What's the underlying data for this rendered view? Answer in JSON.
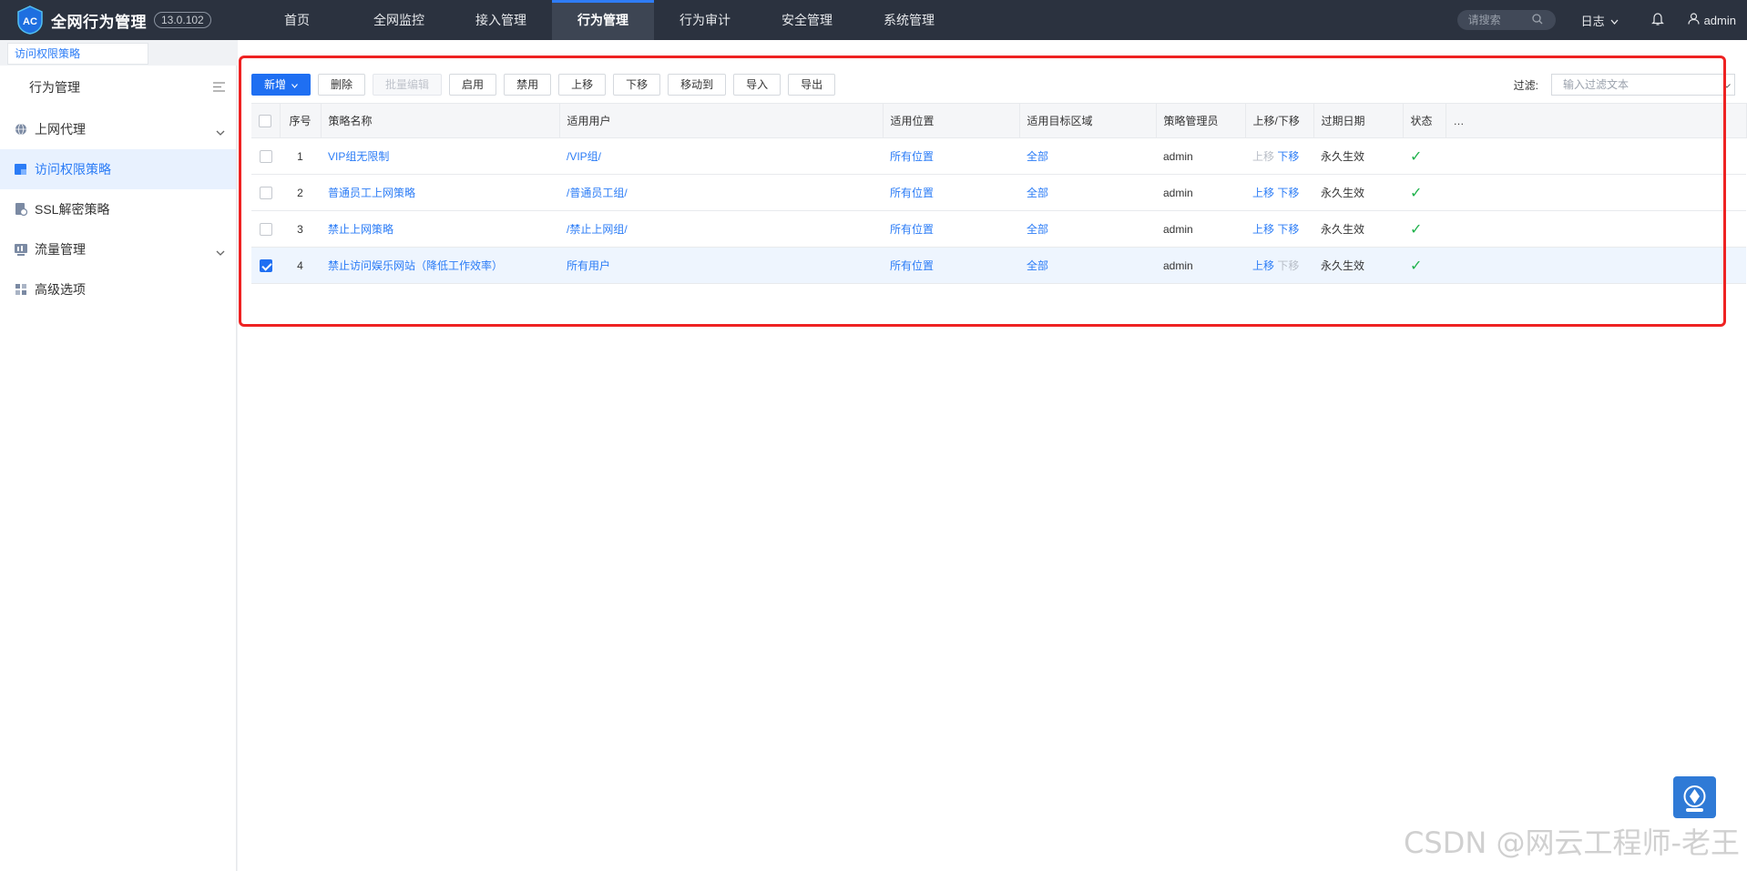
{
  "app": {
    "logo_text": "AC",
    "title": "全网行为管理",
    "version": "13.0.102"
  },
  "nav": {
    "items": [
      {
        "label": "首页"
      },
      {
        "label": "全网监控"
      },
      {
        "label": "接入管理"
      },
      {
        "label": "行为管理",
        "active": true
      },
      {
        "label": "行为审计"
      },
      {
        "label": "安全管理"
      },
      {
        "label": "系统管理"
      }
    ]
  },
  "topright": {
    "search_placeholder": "请搜索",
    "log_label": "日志",
    "user": "admin"
  },
  "breadcrumb": {
    "tab": "访问权限策略"
  },
  "sidebar": {
    "header": "行为管理",
    "items": [
      {
        "label": "上网代理",
        "icon": "globe-icon",
        "expandable": true
      },
      {
        "label": "访问权限策略",
        "icon": "shield-icon",
        "active": true
      },
      {
        "label": "SSL解密策略",
        "icon": "lock-doc-icon"
      },
      {
        "label": "流量管理",
        "icon": "traffic-icon",
        "expandable": true
      },
      {
        "label": "高级选项",
        "icon": "grid-icon"
      }
    ]
  },
  "toolbar": {
    "new": "新增",
    "delete": "删除",
    "batch_edit": "批量编辑",
    "enable": "启用",
    "disable": "禁用",
    "move_up": "上移",
    "move_down": "下移",
    "move_to": "移动到",
    "import": "导入",
    "export": "导出"
  },
  "filter": {
    "label": "过滤:",
    "placeholder": "输入过滤文本"
  },
  "table": {
    "headers": {
      "index": "序号",
      "name": "策略名称",
      "users": "适用用户",
      "location": "适用位置",
      "zone": "适用目标区域",
      "admin": "策略管理员",
      "order": "上移/下移",
      "expire": "过期日期",
      "status": "状态"
    },
    "rows": [
      {
        "index": "1",
        "name": "VIP组无限制",
        "users": "/VIP组/",
        "location": "所有位置",
        "zone": "全部",
        "admin": "admin",
        "up": "上移",
        "down": "下移",
        "expire": "永久生效",
        "checked": false,
        "up_enabled": false,
        "down_enabled": true
      },
      {
        "index": "2",
        "name": "普通员工上网策略",
        "users": "/普通员工组/",
        "location": "所有位置",
        "zone": "全部",
        "admin": "admin",
        "up": "上移",
        "down": "下移",
        "expire": "永久生效",
        "checked": false,
        "up_enabled": true,
        "down_enabled": true
      },
      {
        "index": "3",
        "name": "禁止上网策略",
        "users": "/禁止上网组/",
        "location": "所有位置",
        "zone": "全部",
        "admin": "admin",
        "up": "上移",
        "down": "下移",
        "expire": "永久生效",
        "checked": false,
        "up_enabled": true,
        "down_enabled": true
      },
      {
        "index": "4",
        "name": "禁止访问娱乐网站（降低工作效率）",
        "users": "所有用户",
        "location": "所有位置",
        "zone": "全部",
        "admin": "admin",
        "up": "上移",
        "down": "下移",
        "expire": "永久生效",
        "checked": true,
        "up_enabled": true,
        "down_enabled": false
      }
    ]
  },
  "status_ok_glyph": "✓",
  "watermark": "CSDN @网云工程师-老王",
  "colors": {
    "accent": "#1f6ff2",
    "topbar": "#2b323f",
    "highlight_box": "#ee2222",
    "status_ok": "#1fb24c"
  }
}
